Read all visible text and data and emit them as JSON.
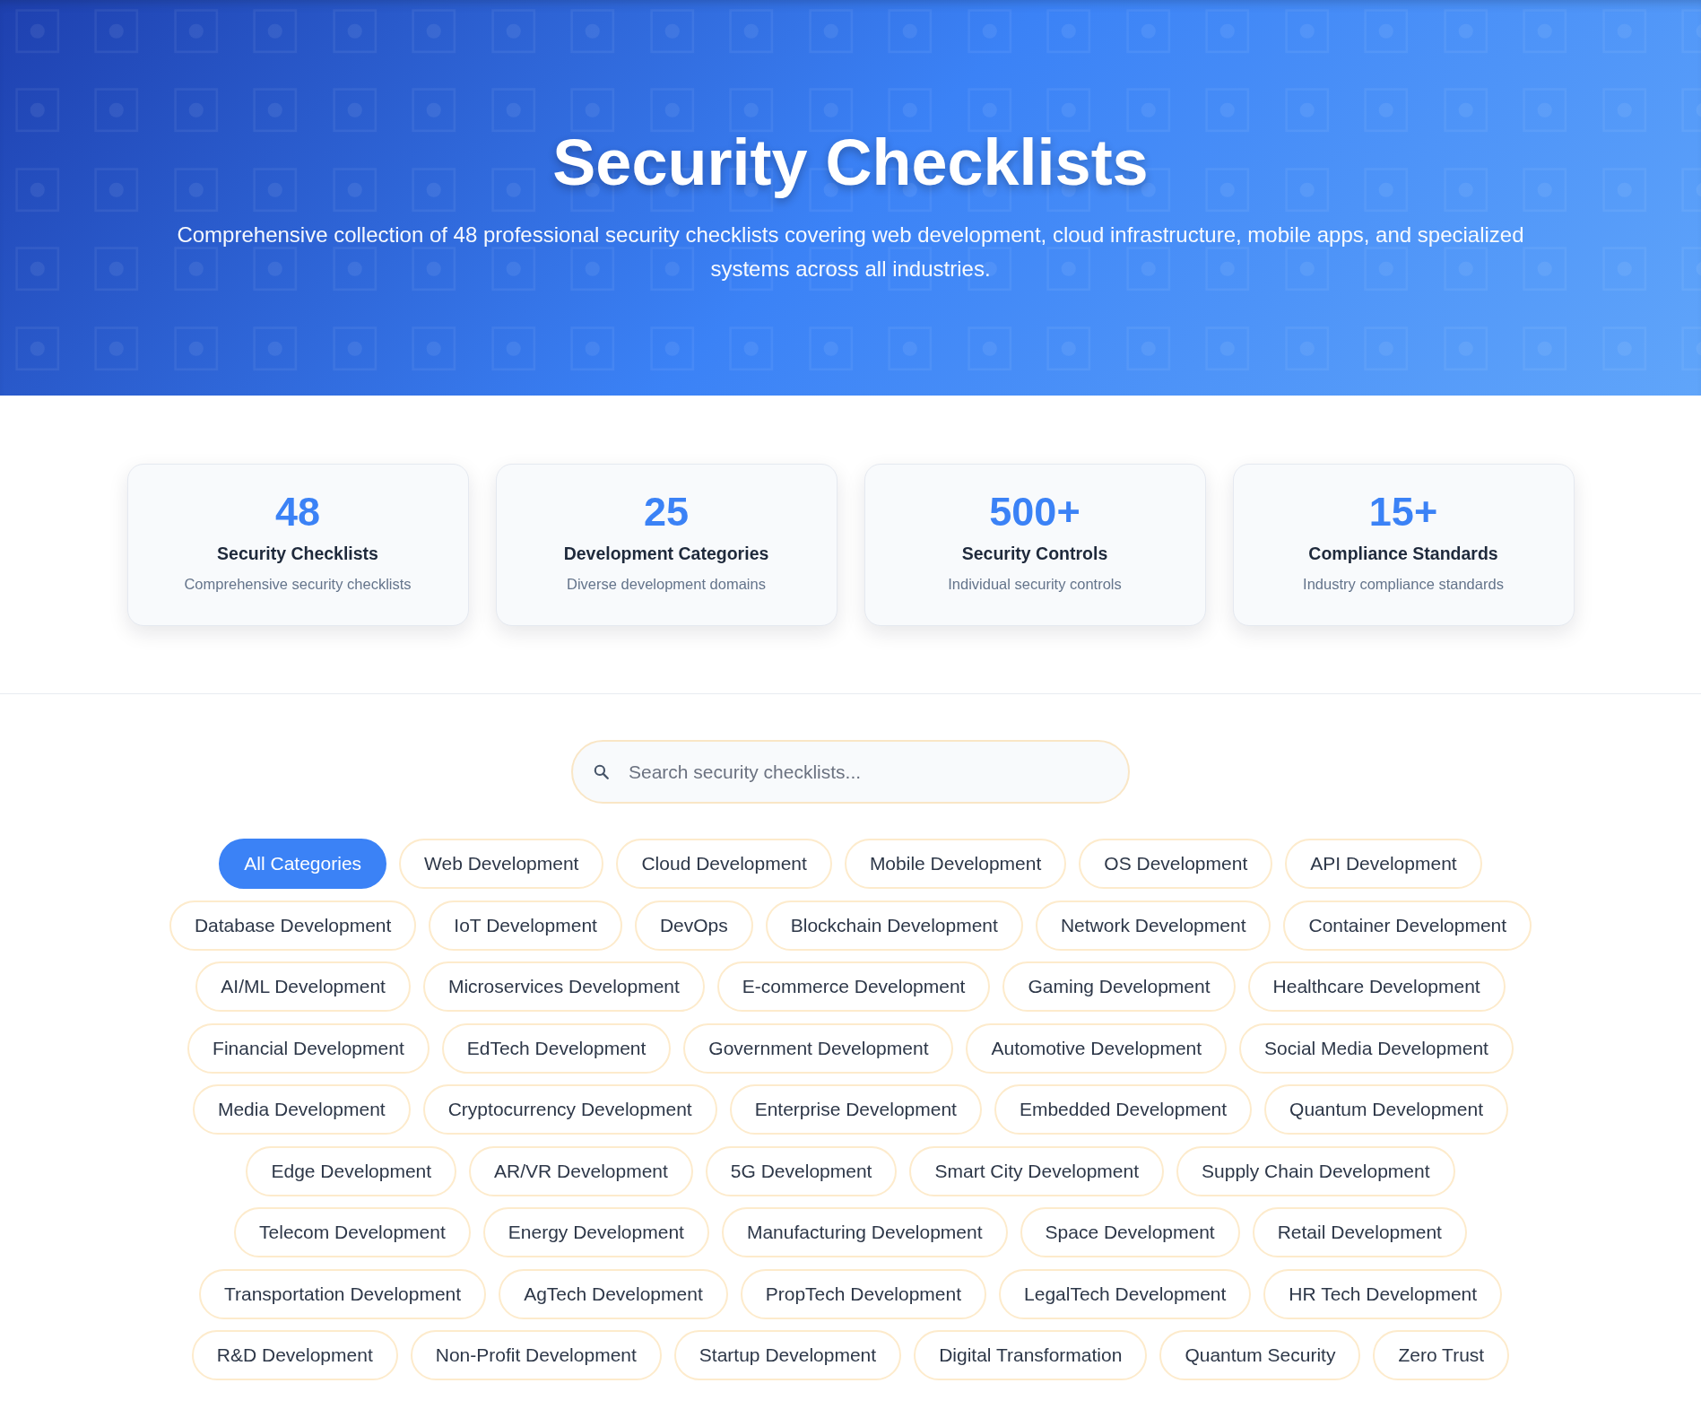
{
  "hero": {
    "title": "Security Checklists",
    "description": "Comprehensive collection of 48 professional security checklists covering web development, cloud infrastructure, mobile apps, and specialized systems across all industries."
  },
  "stats": [
    {
      "value": "48",
      "label": "Security Checklists",
      "description": "Comprehensive security checklists"
    },
    {
      "value": "25",
      "label": "Development Categories",
      "description": "Diverse development domains"
    },
    {
      "value": "500+",
      "label": "Security Controls",
      "description": "Individual security controls"
    },
    {
      "value": "15+",
      "label": "Compliance Standards",
      "description": "Industry compliance standards"
    }
  ],
  "search": {
    "placeholder": "Search security checklists..."
  },
  "categories": [
    {
      "label": "All Categories",
      "selected": true
    },
    {
      "label": "Web Development",
      "selected": false
    },
    {
      "label": "Cloud Development",
      "selected": false
    },
    {
      "label": "Mobile Development",
      "selected": false
    },
    {
      "label": "OS Development",
      "selected": false
    },
    {
      "label": "API Development",
      "selected": false
    },
    {
      "label": "Database Development",
      "selected": false
    },
    {
      "label": "IoT Development",
      "selected": false
    },
    {
      "label": "DevOps",
      "selected": false
    },
    {
      "label": "Blockchain Development",
      "selected": false
    },
    {
      "label": "Network Development",
      "selected": false
    },
    {
      "label": "Container Development",
      "selected": false
    },
    {
      "label": "AI/ML Development",
      "selected": false
    },
    {
      "label": "Microservices Development",
      "selected": false
    },
    {
      "label": "E-commerce Development",
      "selected": false
    },
    {
      "label": "Gaming Development",
      "selected": false
    },
    {
      "label": "Healthcare Development",
      "selected": false
    },
    {
      "label": "Financial Development",
      "selected": false
    },
    {
      "label": "EdTech Development",
      "selected": false
    },
    {
      "label": "Government Development",
      "selected": false
    },
    {
      "label": "Automotive Development",
      "selected": false
    },
    {
      "label": "Social Media Development",
      "selected": false
    },
    {
      "label": "Media Development",
      "selected": false
    },
    {
      "label": "Cryptocurrency Development",
      "selected": false
    },
    {
      "label": "Enterprise Development",
      "selected": false
    },
    {
      "label": "Embedded Development",
      "selected": false
    },
    {
      "label": "Quantum Development",
      "selected": false
    },
    {
      "label": "Edge Development",
      "selected": false
    },
    {
      "label": "AR/VR Development",
      "selected": false
    },
    {
      "label": "5G Development",
      "selected": false
    },
    {
      "label": "Smart City Development",
      "selected": false
    },
    {
      "label": "Supply Chain Development",
      "selected": false
    },
    {
      "label": "Telecom Development",
      "selected": false
    },
    {
      "label": "Energy Development",
      "selected": false
    },
    {
      "label": "Manufacturing Development",
      "selected": false
    },
    {
      "label": "Space Development",
      "selected": false
    },
    {
      "label": "Retail Development",
      "selected": false
    },
    {
      "label": "Transportation Development",
      "selected": false
    },
    {
      "label": "AgTech Development",
      "selected": false
    },
    {
      "label": "PropTech Development",
      "selected": false
    },
    {
      "label": "LegalTech Development",
      "selected": false
    },
    {
      "label": "HR Tech Development",
      "selected": false
    },
    {
      "label": "R&D Development",
      "selected": false
    },
    {
      "label": "Non-Profit Development",
      "selected": false
    },
    {
      "label": "Startup Development",
      "selected": false
    },
    {
      "label": "Digital Transformation",
      "selected": false
    },
    {
      "label": "Quantum Security",
      "selected": false
    },
    {
      "label": "Zero Trust",
      "selected": false
    }
  ]
}
